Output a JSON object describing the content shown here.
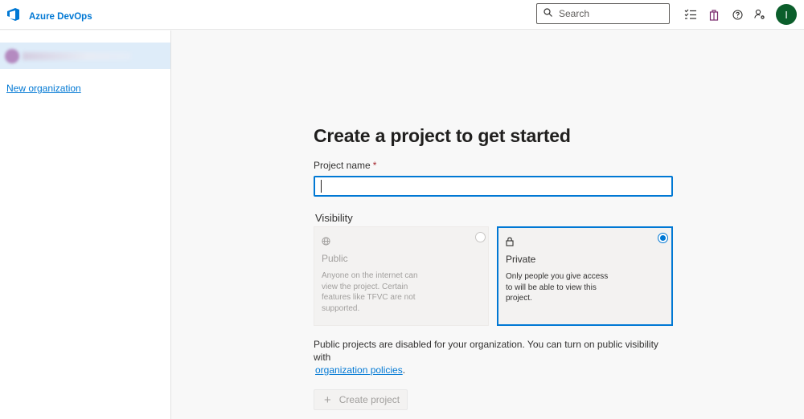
{
  "header": {
    "app_title": "Azure DevOps",
    "search_placeholder": "Search",
    "avatar_initial": "I"
  },
  "sidebar": {
    "new_org_label": "New organization"
  },
  "main": {
    "title": "Create a project to get started",
    "project_name_label": "Project name",
    "required_marker": "*",
    "project_name_value": "",
    "visibility_label": "Visibility",
    "options": [
      {
        "title": "Public",
        "description": "Anyone on the internet can view the project. Certain features like TFVC are not supported.",
        "selected": false,
        "disabled": true
      },
      {
        "title": "Private",
        "description": "Only people you give access to will be able to view this project.",
        "selected": true,
        "disabled": false
      }
    ],
    "note_text": "Public projects are disabled for your organization. You can turn on public visibility with",
    "note_link": "organization policies",
    "note_suffix": ".",
    "create_button": "Create project"
  },
  "colors": {
    "accent": "#0078d4",
    "avatar_bg": "#0b5e2b",
    "required": "#a4262c"
  }
}
